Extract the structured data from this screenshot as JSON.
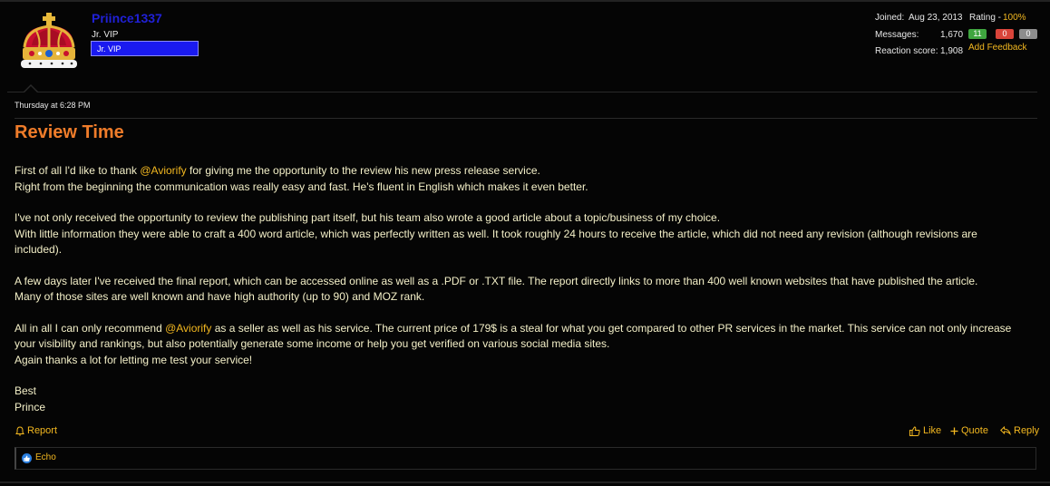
{
  "user": {
    "name": "Priince1337",
    "title": "Jr. VIP",
    "banner": "Jr. VIP"
  },
  "stats": {
    "joined_label": "Joined:",
    "joined_value": "Aug 23, 2013",
    "rating_label": "Rating -",
    "rating_value": "100%",
    "messages_label": "Messages:",
    "messages_value": "1,670",
    "feedback_positive": "11",
    "feedback_negative": "0",
    "feedback_neutral": "0",
    "reaction_label": "Reaction score:",
    "reaction_value": "1,908",
    "add_feedback": "Add Feedback"
  },
  "post": {
    "date": "Thursday at 6:28 PM",
    "title": "Review Time",
    "p1_a": "First of all I'd like to thank ",
    "mention": "@Aviorify",
    "p1_b": " for giving me the opportunity to the review his new press release service.",
    "p1_c": "Right from the beginning the communication was really easy and fast. He's fluent in English which makes it even better.",
    "p2_a": "I've not only received the opportunity to review the publishing part itself, but his team also wrote a good article about a topic/business of my choice.",
    "p2_b": "With little information they were able to craft a 400 word article, which was perfectly written as well. It took roughly 24 hours to receive the article, which did not need any revision (although revisions are included).",
    "p3_a": "A few days later I've received the final report, which can be accessed online as well as a .PDF or .TXT file. The report directly links to more than 400 well known websites that have published the article.",
    "p3_b": "Many of those sites are well known and have high authority (up to 90) and MOZ rank.",
    "p4_a": "All in all I can only recommend ",
    "p4_b": " as a seller as well as his service. The current price of 179$ is a steal for what you get compared to other PR services in the market. This service can not only increase your visibility and rankings, but also potentially generate some income or help you get verified on various social media sites.",
    "p4_c": "Again thanks a lot for letting me test your service!",
    "sig_1": "Best",
    "sig_2": "Prince"
  },
  "actions": {
    "report": "Report",
    "like": "Like",
    "quote": "Quote",
    "reply": "Reply"
  },
  "reactions": {
    "user": "Echo",
    "icon": "thumbs-up-icon"
  },
  "colors": {
    "accent": "#f3b820",
    "title": "#ef7c2a",
    "username": "#2020d6"
  }
}
